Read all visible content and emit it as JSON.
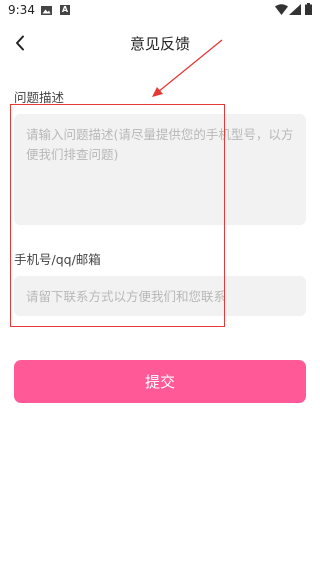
{
  "status_bar": {
    "time": "9:34",
    "a_badge": "A",
    "icons": [
      "image-icon",
      "a-badge-icon",
      "wifi-icon",
      "signal-icon",
      "battery-icon"
    ]
  },
  "nav": {
    "title": "意见反馈",
    "back_icon": "chevron-left-icon"
  },
  "form": {
    "description_label": "问题描述",
    "description_placeholder": "请输入问题描述(请尽量提供您的手机型号，以方便我们排查问题)",
    "description_value": "",
    "contact_label": "手机号/qq/邮箱",
    "contact_placeholder": "请留下联系方式以方便我们和您联系",
    "contact_value": "",
    "submit_label": "提交"
  },
  "colors": {
    "accent": "#ff5a97",
    "annotation": "#e53935",
    "input_bg": "#f2f2f2"
  }
}
